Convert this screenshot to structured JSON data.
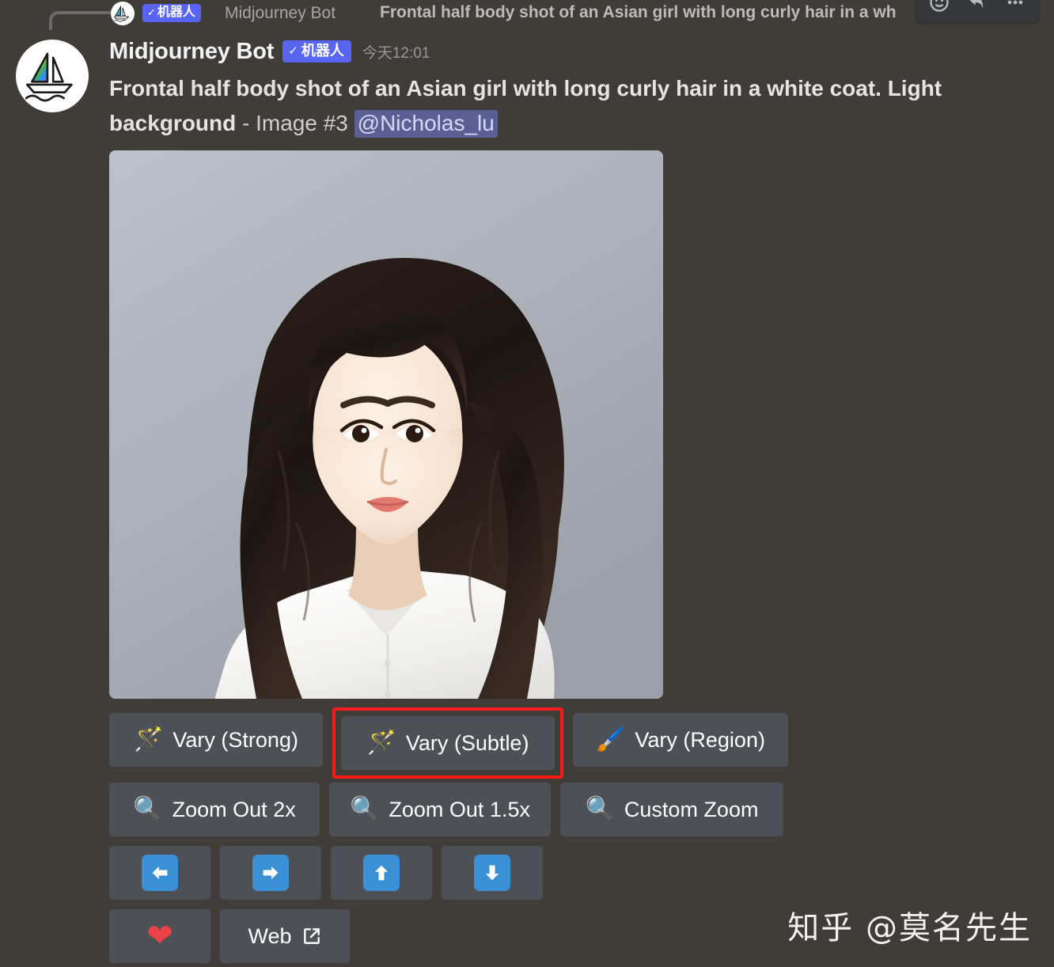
{
  "reply_context": {
    "avatar_icon": "midjourney-sailboat-logo",
    "bot_badge_check": "✓",
    "bot_badge_label": "机器人",
    "author": "Midjourney Bot",
    "preview_text": "Frontal half body shot of an Asian girl with long curly hair in a wh"
  },
  "hover_toolbar": {
    "items": [
      {
        "icon": "add-reaction-icon"
      },
      {
        "icon": "reply-icon"
      },
      {
        "icon": "more-options-icon"
      }
    ]
  },
  "message": {
    "avatar_icon": "midjourney-sailboat-logo",
    "author": "Midjourney Bot",
    "bot_badge_check": "✓",
    "bot_badge_label": "机器人",
    "timestamp": "今天12:01",
    "prompt": "Frontal half body shot of an Asian girl with long curly hair in a white coat. Light background",
    "suffix": " - Image #3 ",
    "mention": "@Nicholas_lu",
    "image_alt": "Asian girl with long curly dark hair wearing a white coat on a light gray background"
  },
  "buttons": {
    "rows": [
      [
        {
          "emoji": "🪄",
          "icon_name": "magic-wand-icon",
          "label": "Vary (Strong)",
          "width_class": "w-vary-strong",
          "highlighted": false
        },
        {
          "emoji": "🪄",
          "icon_name": "magic-wand-icon",
          "label": "Vary (Subtle)",
          "width_class": "w-vary-subtle",
          "highlighted": true
        },
        {
          "emoji": "🖌️",
          "icon_name": "paintbrush-icon",
          "label": "Vary (Region)",
          "width_class": "w-vary-region",
          "highlighted": false
        }
      ],
      [
        {
          "emoji": "🔍",
          "icon_name": "magnifier-icon",
          "label": "Zoom Out 2x",
          "width_class": "w-zoom2x",
          "highlighted": false
        },
        {
          "emoji": "🔍",
          "icon_name": "magnifier-icon",
          "label": "Zoom Out 1.5x",
          "width_class": "w-zoom15x",
          "highlighted": false
        },
        {
          "emoji": "🔍",
          "icon_name": "magnifier-icon",
          "label": "Custom Zoom",
          "width_class": "w-customzoom",
          "highlighted": false
        }
      ],
      [
        {
          "icon_name": "arrow-left-icon",
          "label": "",
          "width_class": "w-arrow",
          "highlighted": false
        },
        {
          "icon_name": "arrow-right-icon",
          "label": "",
          "width_class": "w-arrow",
          "highlighted": false
        },
        {
          "icon_name": "arrow-up-icon",
          "label": "",
          "width_class": "w-arrow",
          "highlighted": false
        },
        {
          "icon_name": "arrow-down-icon",
          "label": "",
          "width_class": "w-arrow",
          "highlighted": false
        }
      ],
      [
        {
          "emoji": "❤️",
          "icon_name": "heart-icon",
          "label": "",
          "width_class": "w-heart",
          "highlighted": false
        },
        {
          "icon_name": "external-link-icon",
          "label": "Web",
          "width_class": "w-web",
          "highlighted": false
        }
      ]
    ]
  },
  "annotation": {
    "highlight_color": "#ff1a1a",
    "target_label": "Vary (Subtle)"
  },
  "watermark": "知乎 @莫名先生",
  "colors": {
    "background": "#403c38",
    "button_bg": "#4e5058",
    "badge_blue": "#5865f2",
    "mention_bg": "#5a5f94",
    "arrow_blue": "#3b8fd4",
    "heart_red": "#ed4245"
  }
}
